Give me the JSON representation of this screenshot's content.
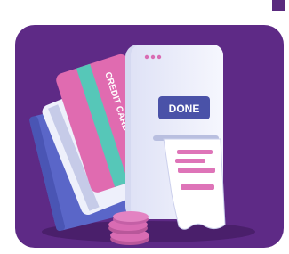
{
  "illustration": {
    "card_label": "CREDIT CARD",
    "done_label": "DONE",
    "colors": {
      "background": "#5e2a86",
      "phone": "#eef0fb",
      "button": "#4a52a8",
      "credit_card": "#e06bb0",
      "stripe": "#56c7b8",
      "blue_card": "#5a66c8",
      "receipt_bar": "#de74b8",
      "coins": "#d96cb3"
    }
  }
}
